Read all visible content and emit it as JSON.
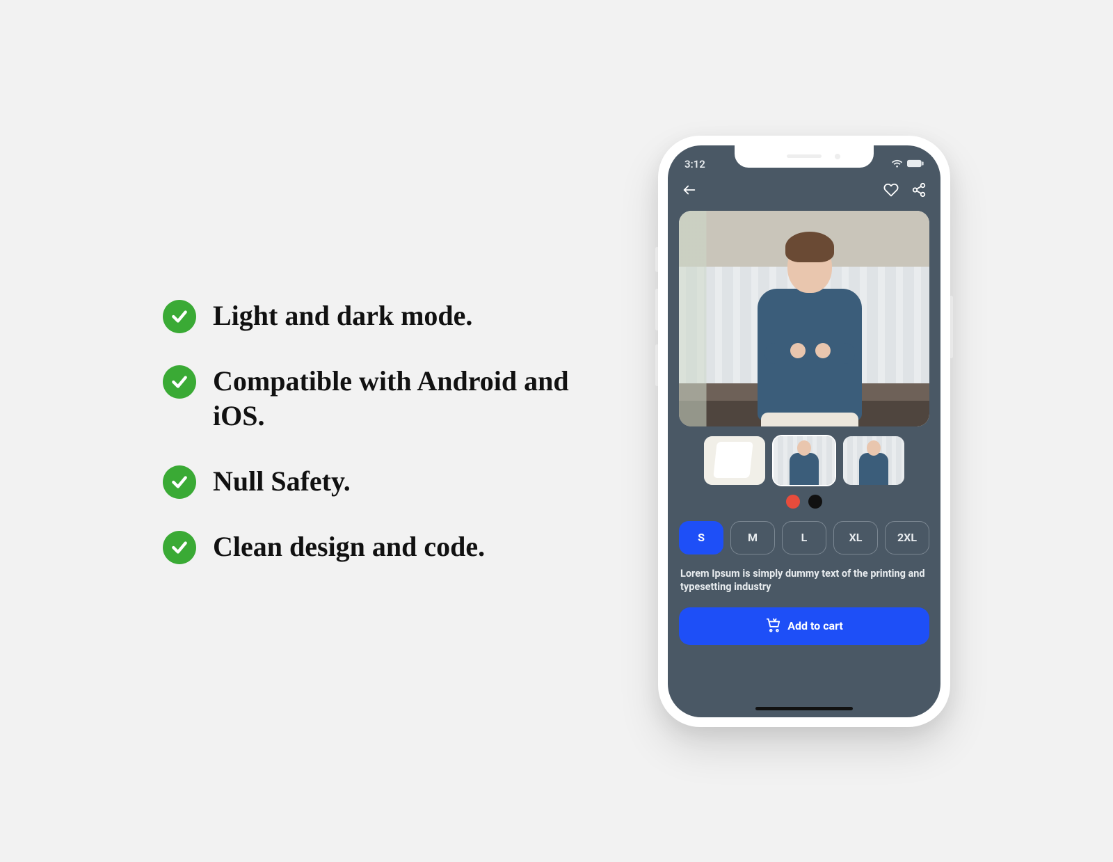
{
  "features": {
    "items": [
      "Light and dark mode.",
      "Compatible with Android and iOS.",
      "Null Safety.",
      "Clean design and code."
    ]
  },
  "phone": {
    "status_time": "3:12",
    "product": {
      "sizes": [
        "S",
        "M",
        "L",
        "XL",
        "2XL"
      ],
      "selected_size": "S",
      "colors": [
        "#e74c3c",
        "#111111"
      ],
      "thumbnails": [
        "hanger",
        "person-crossed",
        "person-phone"
      ],
      "description": "Lorem Ipsum is simply dummy text of the printing and typesetting industry",
      "cta_label": "Add to cart"
    }
  }
}
